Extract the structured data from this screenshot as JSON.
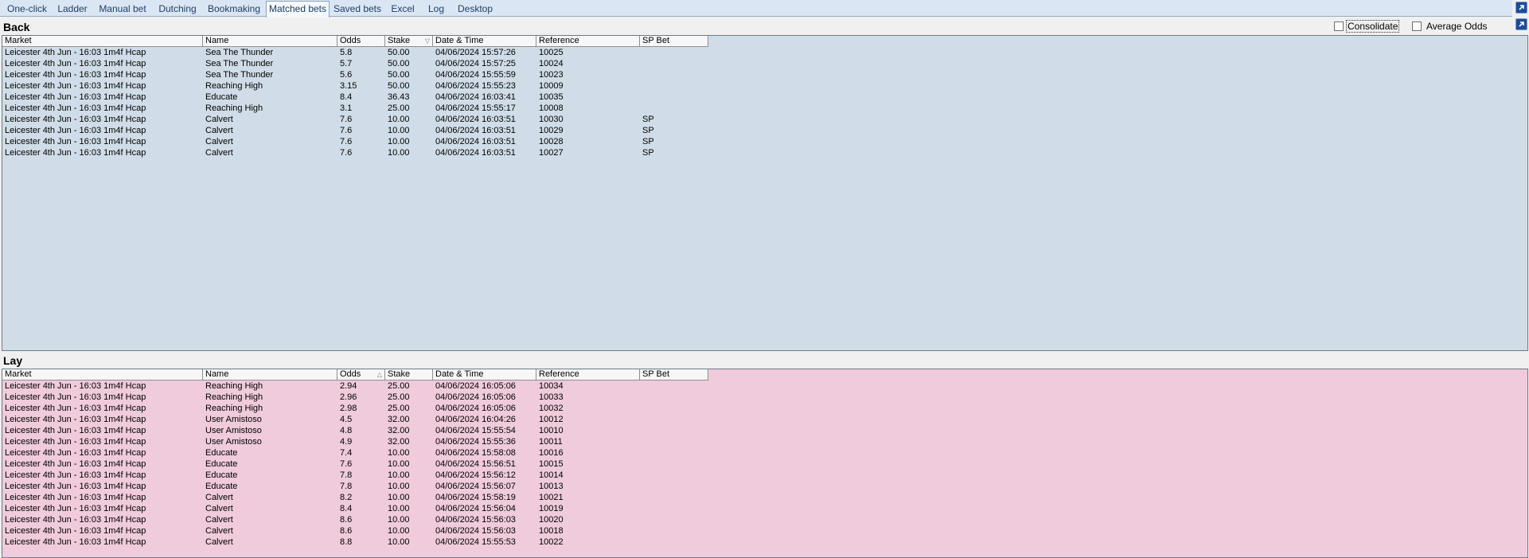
{
  "tabs": [
    {
      "label": "One-click",
      "active": false
    },
    {
      "label": "Ladder",
      "active": false
    },
    {
      "label": "Manual bet",
      "active": false
    },
    {
      "label": "Dutching",
      "active": false
    },
    {
      "label": "Bookmaking",
      "active": false
    },
    {
      "label": "Matched bets",
      "active": true
    },
    {
      "label": "Saved bets",
      "active": false
    },
    {
      "label": "Excel",
      "active": false
    },
    {
      "label": "Log",
      "active": false
    },
    {
      "label": "Desktop",
      "active": false
    }
  ],
  "options": {
    "consolidate": "Consolidate",
    "average_odds": "Average Odds"
  },
  "columns": [
    "Market",
    "Name",
    "Odds",
    "Stake",
    "Date & Time",
    "Reference",
    "SP Bet"
  ],
  "back": {
    "title": "Back",
    "sort_column": "Stake",
    "rows": [
      [
        "Leicester 4th Jun - 16:03 1m4f Hcap",
        "Sea The Thunder",
        "5.8",
        "50.00",
        "04/06/2024 15:57:26",
        "10025",
        ""
      ],
      [
        "Leicester 4th Jun - 16:03 1m4f Hcap",
        "Sea The Thunder",
        "5.7",
        "50.00",
        "04/06/2024 15:57:25",
        "10024",
        ""
      ],
      [
        "Leicester 4th Jun - 16:03 1m4f Hcap",
        "Sea The Thunder",
        "5.6",
        "50.00",
        "04/06/2024 15:55:59",
        "10023",
        ""
      ],
      [
        "Leicester 4th Jun - 16:03 1m4f Hcap",
        "Reaching High",
        "3.15",
        "50.00",
        "04/06/2024 15:55:23",
        "10009",
        ""
      ],
      [
        "Leicester 4th Jun - 16:03 1m4f Hcap",
        "Educate",
        "8.4",
        "36.43",
        "04/06/2024 16:03:41",
        "10035",
        ""
      ],
      [
        "Leicester 4th Jun - 16:03 1m4f Hcap",
        "Reaching High",
        "3.1",
        "25.00",
        "04/06/2024 15:55:17",
        "10008",
        ""
      ],
      [
        "Leicester 4th Jun - 16:03 1m4f Hcap",
        "Calvert",
        "7.6",
        "10.00",
        "04/06/2024 16:03:51",
        "10030",
        "SP"
      ],
      [
        "Leicester 4th Jun - 16:03 1m4f Hcap",
        "Calvert",
        "7.6",
        "10.00",
        "04/06/2024 16:03:51",
        "10029",
        "SP"
      ],
      [
        "Leicester 4th Jun - 16:03 1m4f Hcap",
        "Calvert",
        "7.6",
        "10.00",
        "04/06/2024 16:03:51",
        "10028",
        "SP"
      ],
      [
        "Leicester 4th Jun - 16:03 1m4f Hcap",
        "Calvert",
        "7.6",
        "10.00",
        "04/06/2024 16:03:51",
        "10027",
        "SP"
      ]
    ]
  },
  "lay": {
    "title": "Lay",
    "sort_column": "Odds",
    "rows": [
      [
        "Leicester 4th Jun - 16:03 1m4f Hcap",
        "Reaching High",
        "2.94",
        "25.00",
        "04/06/2024 16:05:06",
        "10034",
        ""
      ],
      [
        "Leicester 4th Jun - 16:03 1m4f Hcap",
        "Reaching High",
        "2.96",
        "25.00",
        "04/06/2024 16:05:06",
        "10033",
        ""
      ],
      [
        "Leicester 4th Jun - 16:03 1m4f Hcap",
        "Reaching High",
        "2.98",
        "25.00",
        "04/06/2024 16:05:06",
        "10032",
        ""
      ],
      [
        "Leicester 4th Jun - 16:03 1m4f Hcap",
        "User Amistoso",
        "4.5",
        "32.00",
        "04/06/2024 16:04:26",
        "10012",
        ""
      ],
      [
        "Leicester 4th Jun - 16:03 1m4f Hcap",
        "User Amistoso",
        "4.8",
        "32.00",
        "04/06/2024 15:55:54",
        "10010",
        ""
      ],
      [
        "Leicester 4th Jun - 16:03 1m4f Hcap",
        "User Amistoso",
        "4.9",
        "32.00",
        "04/06/2024 15:55:36",
        "10011",
        ""
      ],
      [
        "Leicester 4th Jun - 16:03 1m4f Hcap",
        "Educate",
        "7.4",
        "10.00",
        "04/06/2024 15:58:08",
        "10016",
        ""
      ],
      [
        "Leicester 4th Jun - 16:03 1m4f Hcap",
        "Educate",
        "7.6",
        "10.00",
        "04/06/2024 15:56:51",
        "10015",
        ""
      ],
      [
        "Leicester 4th Jun - 16:03 1m4f Hcap",
        "Educate",
        "7.8",
        "10.00",
        "04/06/2024 15:56:12",
        "10014",
        ""
      ],
      [
        "Leicester 4th Jun - 16:03 1m4f Hcap",
        "Educate",
        "7.8",
        "10.00",
        "04/06/2024 15:56:07",
        "10013",
        ""
      ],
      [
        "Leicester 4th Jun - 16:03 1m4f Hcap",
        "Calvert",
        "8.2",
        "10.00",
        "04/06/2024 15:58:19",
        "10021",
        ""
      ],
      [
        "Leicester 4th Jun - 16:03 1m4f Hcap",
        "Calvert",
        "8.4",
        "10.00",
        "04/06/2024 15:56:04",
        "10019",
        ""
      ],
      [
        "Leicester 4th Jun - 16:03 1m4f Hcap",
        "Calvert",
        "8.6",
        "10.00",
        "04/06/2024 15:56:03",
        "10020",
        ""
      ],
      [
        "Leicester 4th Jun - 16:03 1m4f Hcap",
        "Calvert",
        "8.6",
        "10.00",
        "04/06/2024 15:56:03",
        "10018",
        ""
      ],
      [
        "Leicester 4th Jun - 16:03 1m4f Hcap",
        "Calvert",
        "8.8",
        "10.00",
        "04/06/2024 15:55:53",
        "10022",
        ""
      ]
    ]
  }
}
